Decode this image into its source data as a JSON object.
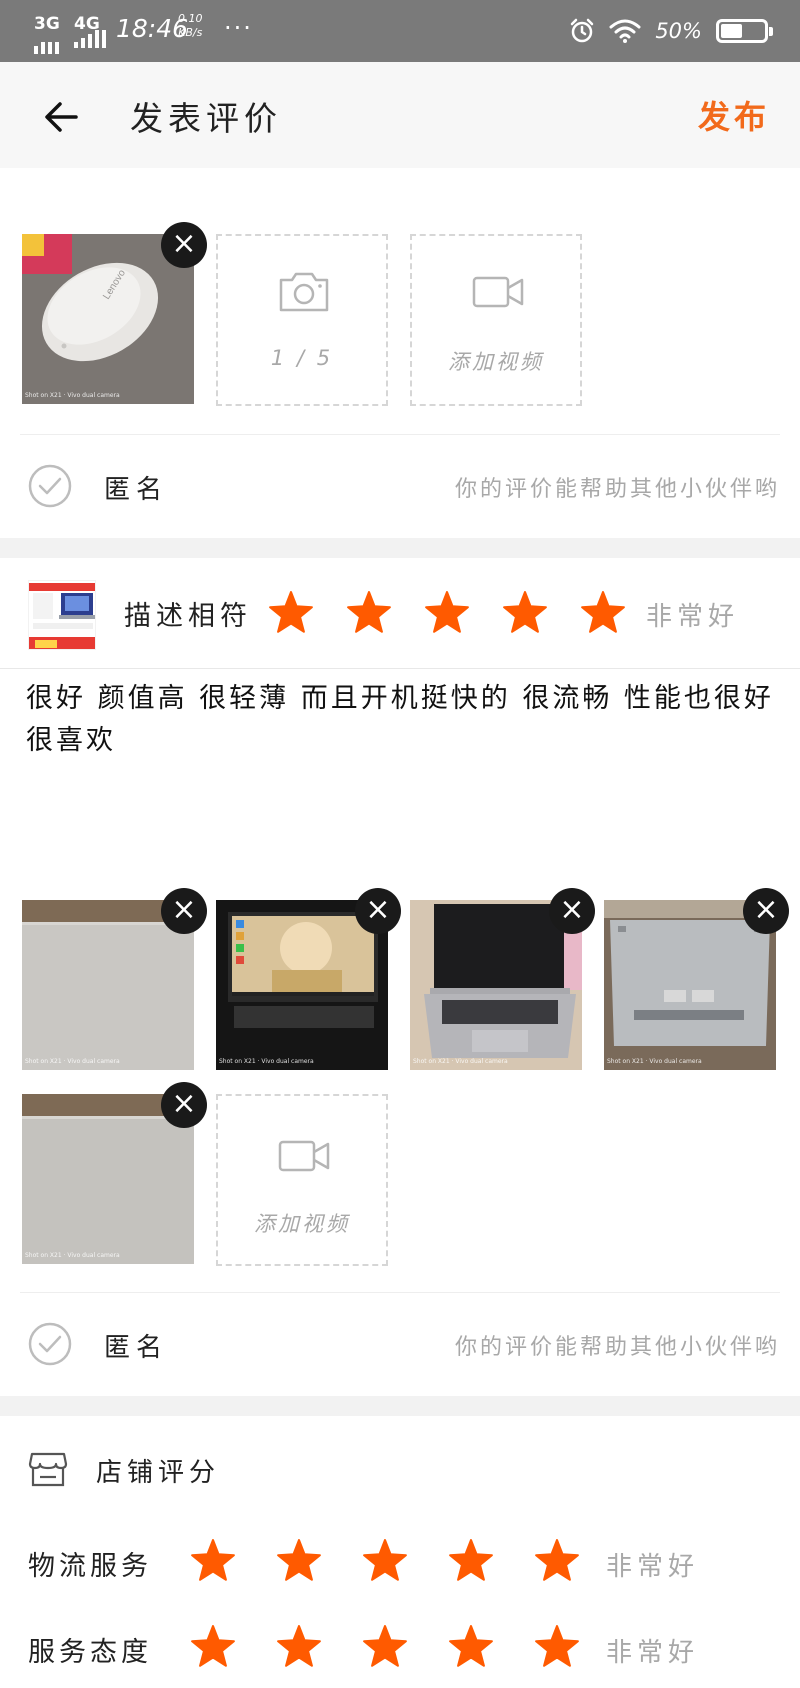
{
  "status_bar": {
    "net1": "3G",
    "net2": "4G",
    "time": "18:46",
    "speed_value": "0.10",
    "speed_unit": "KB/s",
    "more": "···",
    "battery_percent": "50%",
    "battery_level": 0.5
  },
  "nav": {
    "back_icon": "arrow-left-icon",
    "title": "发表评价",
    "publish_label": "发布"
  },
  "colors": {
    "accent": "#f26a1b",
    "star": "#ff5a00",
    "hint": "#a8a8a8"
  },
  "section1": {
    "photo_stamp": "Shot on X21 · Vivo dual camera",
    "add_photo_icon": "camera-icon",
    "add_photo_count": "1 / 5",
    "add_video_icon": "video-camera-icon",
    "add_video_label": "添加视频",
    "anonymous_label": "匿名",
    "anonymous_hint": "你的评价能帮助其他小伙伴哟"
  },
  "product_review": {
    "rating_label": "描述相符",
    "stars": 5,
    "rating_text": "非常好",
    "text": "很好 颜值高 很轻薄 而且开机挺快的 很流畅 性能也很好 很喜欢",
    "add_video_label": "添加视频",
    "anonymous_label": "匿名",
    "anonymous_hint": "你的评价能帮助其他小伙伴哟"
  },
  "shop": {
    "store_icon": "store-icon",
    "title": "店铺评分",
    "rows": [
      {
        "label": "物流服务",
        "stars": 5,
        "rating_text": "非常好"
      },
      {
        "label": "服务态度",
        "stars": 5,
        "rating_text": "非常好"
      }
    ]
  }
}
